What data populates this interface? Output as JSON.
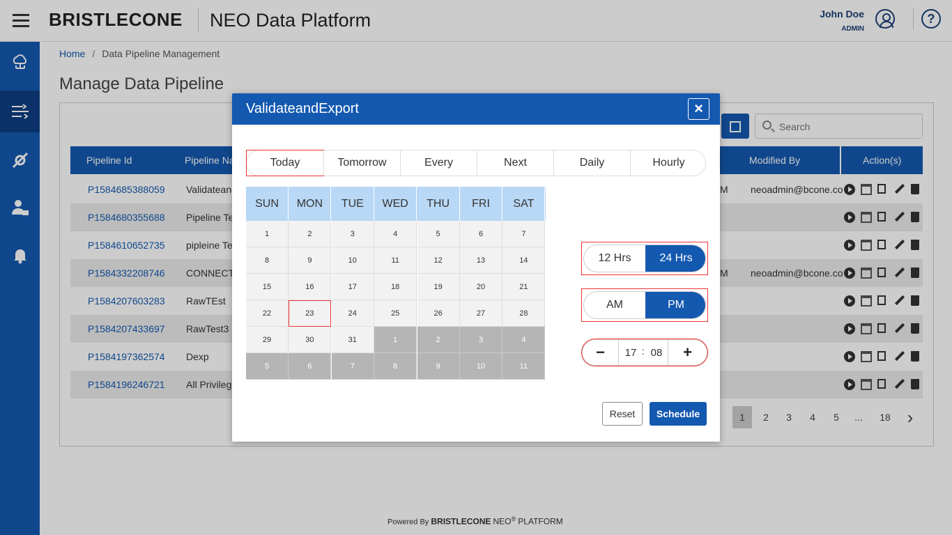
{
  "header": {
    "logo_text": "BRISTLECONE",
    "app_title": "NEO Data Platform",
    "user_name": "John Doe",
    "user_role": "ADMIN",
    "help_glyph": "?"
  },
  "sidebar": {
    "items": [
      {
        "icon": "cloud-network-icon",
        "active": false
      },
      {
        "icon": "pipeline-icon",
        "active": true
      },
      {
        "icon": "settings-tools-icon",
        "active": false
      },
      {
        "icon": "user-lock-icon",
        "active": false
      },
      {
        "icon": "bell-icon",
        "active": false
      }
    ]
  },
  "breadcrumb": {
    "home": "Home",
    "separator": "/",
    "current": "Data Pipeline Management"
  },
  "page": {
    "title": "Manage Data Pipeline"
  },
  "search": {
    "placeholder": "Search"
  },
  "table": {
    "headers": {
      "pipeline_id": "Pipeline Id",
      "pipeline_name": "Pipeline Na",
      "modified_by": "Modified By",
      "actions": "Action(s)"
    },
    "rows": [
      {
        "id": "P1584685388059",
        "name": "Validateand",
        "modified": "M",
        "modified_by": "neoadmin@bcone.co"
      },
      {
        "id": "P1584680355688",
        "name": "Pipeline Te",
        "modified": "",
        "modified_by": ""
      },
      {
        "id": "P1584610652735",
        "name": "pipleine Te",
        "modified": "",
        "modified_by": ""
      },
      {
        "id": "P1584332208746",
        "name": "CONNECTI",
        "modified": "M",
        "modified_by": "neoadmin@bcone.co"
      },
      {
        "id": "P1584207603283",
        "name": "RawTEst",
        "modified": "",
        "modified_by": ""
      },
      {
        "id": "P1584207433697",
        "name": "RawTest3",
        "modified": "",
        "modified_by": ""
      },
      {
        "id": "P1584197362574",
        "name": "Dexp",
        "modified": "",
        "modified_by": ""
      },
      {
        "id": "P1584196246721",
        "name": "All Privilege",
        "modified": "",
        "modified_by": ""
      }
    ]
  },
  "pagination": {
    "pages": [
      "1",
      "2",
      "3",
      "4",
      "5",
      "...",
      "18"
    ],
    "current": "1",
    "next": "›"
  },
  "footer": {
    "powered_by": "Powered By",
    "brand": "BRISTLECONE",
    "neo": "NEO",
    "reg": "®",
    "platform": "PLATFORM"
  },
  "modal": {
    "title": "ValidateandExport",
    "close": "×",
    "tabs": [
      "Today",
      "Tomorrow",
      "Every",
      "Next",
      "Daily",
      "Hourly"
    ],
    "selected_tab": "Today",
    "calendar": {
      "weekdays": [
        "SUN",
        "MON",
        "TUE",
        "WED",
        "THU",
        "FRI",
        "SAT"
      ],
      "weeks": [
        [
          "1",
          "2",
          "3",
          "4",
          "5",
          "6",
          "7"
        ],
        [
          "8",
          "9",
          "10",
          "11",
          "12",
          "13",
          "14"
        ],
        [
          "15",
          "16",
          "17",
          "18",
          "19",
          "20",
          "21"
        ],
        [
          "22",
          "23",
          "24",
          "25",
          "26",
          "27",
          "28"
        ],
        [
          "29",
          "30",
          "31",
          "1",
          "2",
          "3",
          "4"
        ],
        [
          "5",
          "6",
          "7",
          "8",
          "9",
          "10",
          "11"
        ]
      ],
      "today": "23"
    },
    "format_toggle": {
      "options": [
        "12 Hrs",
        "24 Hrs"
      ],
      "selected": "24 Hrs"
    },
    "ampm_toggle": {
      "options": [
        "AM",
        "PM"
      ],
      "selected": "PM"
    },
    "time": {
      "minus": "−",
      "hours": "17",
      "separator": ":",
      "minutes": "08",
      "plus": "+"
    },
    "reset_label": "Reset",
    "schedule_label": "Schedule"
  },
  "colors": {
    "brand": "#1459b0",
    "sidebar_active": "#0e3f82",
    "calendar_header": "#b8d8f5",
    "highlight": "#ee3333"
  }
}
